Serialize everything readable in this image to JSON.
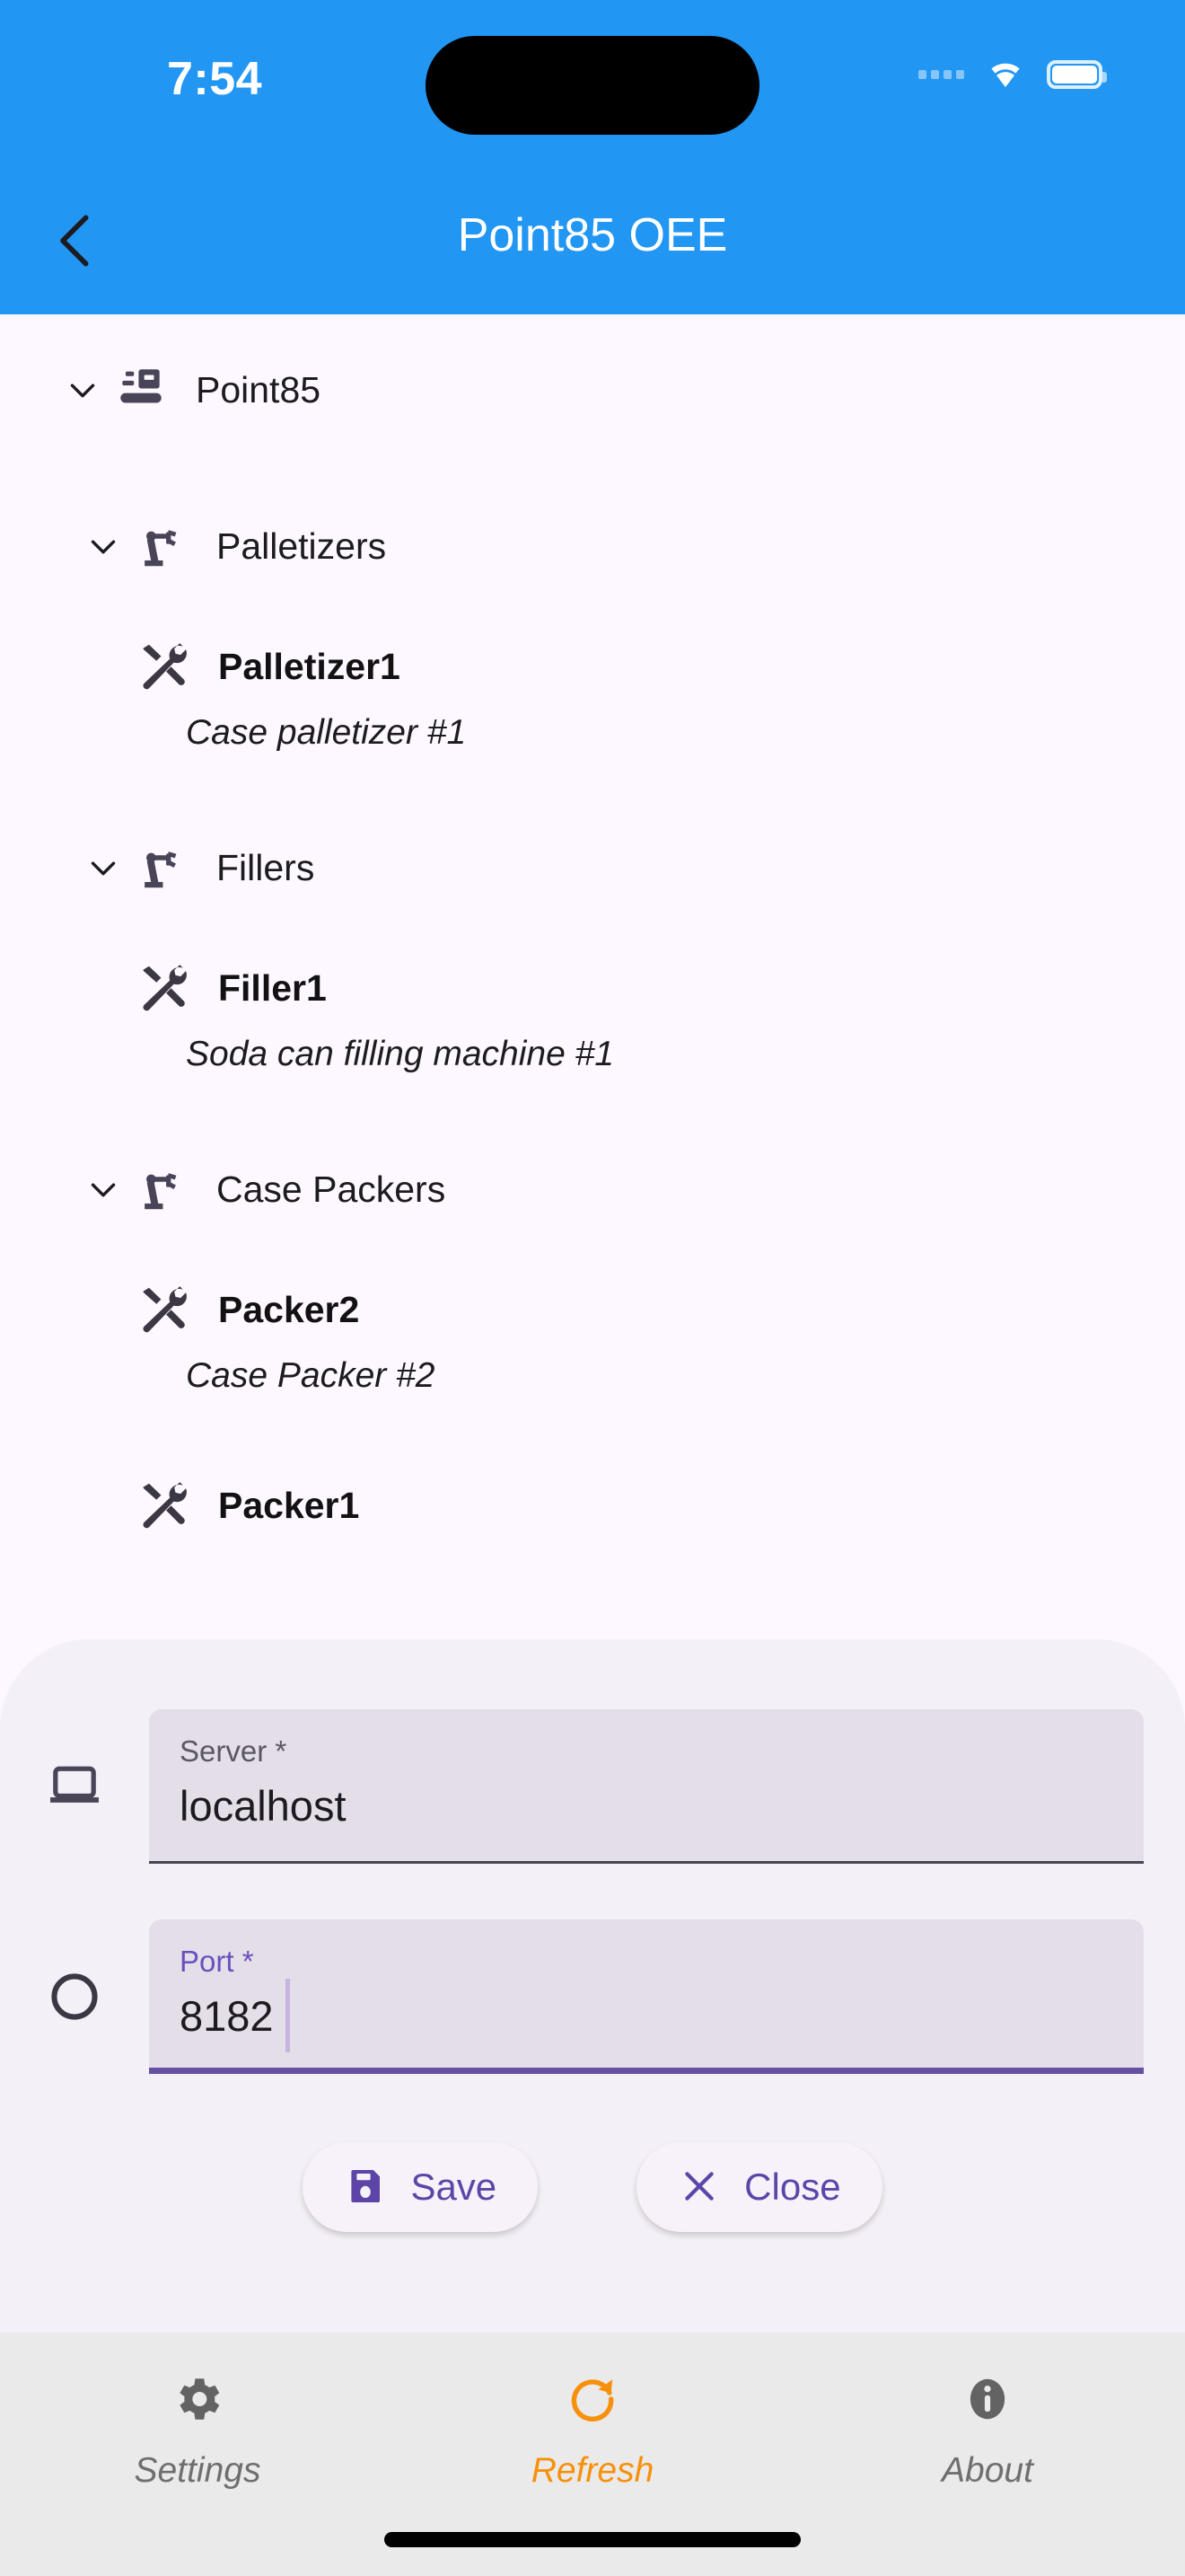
{
  "status_bar": {
    "time": "7:54",
    "wifi_icon": "wifi-icon",
    "battery_icon": "battery-icon",
    "signal_icon": "signal-dots-icon"
  },
  "app_bar": {
    "back_icon": "chevron-left-icon",
    "title": "Point85 OEE",
    "background_color": "#2196F3"
  },
  "tree": {
    "nodes": [
      {
        "label": "Point85",
        "icon": "production-line-icon",
        "chevron": "chevron-down-icon",
        "level": 0,
        "type": "branch"
      },
      {
        "label": "Palletizers",
        "icon": "robot-arm-icon",
        "chevron": "chevron-down-icon",
        "level": 1,
        "type": "branch"
      },
      {
        "label": "Palletizer1",
        "description": "Case palletizer #1",
        "icon": "tools-icon",
        "level": 2,
        "type": "leaf"
      },
      {
        "label": "Fillers",
        "icon": "robot-arm-icon",
        "chevron": "chevron-down-icon",
        "level": 1,
        "type": "branch"
      },
      {
        "label": "Filler1",
        "description": "Soda can filling machine #1",
        "icon": "tools-icon",
        "level": 2,
        "type": "leaf"
      },
      {
        "label": "Case Packers",
        "icon": "robot-arm-icon",
        "chevron": "chevron-down-icon",
        "level": 1,
        "type": "branch"
      },
      {
        "label": "Packer2",
        "description": "Case Packer #2",
        "icon": "tools-icon",
        "level": 2,
        "type": "leaf"
      },
      {
        "label": "Packer1",
        "icon": "tools-icon",
        "level": 2,
        "type": "leaf"
      }
    ]
  },
  "sheet": {
    "fields": [
      {
        "lead_icon": "laptop-icon",
        "label": "Server *",
        "value": "localhost",
        "focused": false
      },
      {
        "lead_icon": "circle-icon",
        "label": "Port *",
        "value": "8182",
        "focused": true
      }
    ],
    "buttons": [
      {
        "label": "Save",
        "icon": "save-floppy-icon"
      },
      {
        "label": "Close",
        "icon": "close-x-icon"
      }
    ],
    "accent_color": "#6750A4",
    "button_text_color": "#5D45A8"
  },
  "bottom_nav": {
    "items": [
      {
        "label": "Settings",
        "icon": "gear-icon",
        "active": false
      },
      {
        "label": "Refresh",
        "icon": "refresh-icon",
        "active": true
      },
      {
        "label": "About",
        "icon": "info-icon",
        "active": false
      }
    ],
    "active_color": "#F7900B",
    "inactive_color": "#6F6F6F"
  }
}
